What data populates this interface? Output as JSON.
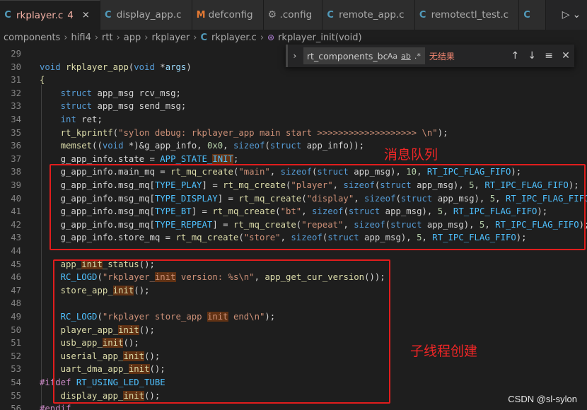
{
  "tabs": [
    {
      "icon": "C",
      "label": "rkplayer.c",
      "badge": "4",
      "close": "×",
      "active": true
    },
    {
      "icon": "C",
      "label": "display_app.c"
    },
    {
      "icon": "M",
      "label": "defconfig"
    },
    {
      "icon": "⚙",
      "label": ".config"
    },
    {
      "icon": "C",
      "label": "remote_app.c"
    },
    {
      "icon": "C",
      "label": "remotectl_test.c"
    },
    {
      "icon": "C",
      "label": ""
    }
  ],
  "tab_actions": {
    "run": "▷",
    "dropdown": "⌄"
  },
  "breadcrumb": {
    "items": [
      "components",
      "hifi4",
      "rtt",
      "app",
      "rkplayer"
    ],
    "file_icon": "C",
    "file": "rkplayer.c",
    "function_icon": "⊛",
    "function": "rkplayer_init(void)"
  },
  "find_widget": {
    "query": "rt_components_bc",
    "opt_case": "Aa",
    "opt_word": "ab",
    "opt_regex": ".*",
    "result": "无结果",
    "toggle": "›",
    "prev": "↑",
    "next": "↓",
    "selection": "≡",
    "close": "✕"
  },
  "annotations": {
    "queue_note": "消息队列",
    "thread_note": "子线程创建"
  },
  "watermark": "CSDN @sl-sylon",
  "code": [
    {
      "n": "29",
      "t": [
        [
          "",
          ""
        ]
      ]
    },
    {
      "n": "30",
      "t": [
        [
          "kw",
          "void"
        ],
        [
          "",
          " "
        ],
        [
          "fn",
          "rkplayer_app"
        ],
        [
          "",
          "("
        ],
        [
          "kw",
          "void"
        ],
        [
          "",
          " *"
        ],
        [
          "var",
          "args"
        ],
        [
          "",
          ")"
        ]
      ]
    },
    {
      "n": "31",
      "t": [
        [
          "fn",
          "{"
        ]
      ]
    },
    {
      "n": "32",
      "t": [
        [
          "",
          "    "
        ],
        [
          "kw",
          "struct"
        ],
        [
          "",
          " app_msg rcv_msg;"
        ]
      ]
    },
    {
      "n": "33",
      "t": [
        [
          "",
          "    "
        ],
        [
          "kw",
          "struct"
        ],
        [
          "",
          " app_msg send_msg;"
        ]
      ]
    },
    {
      "n": "34",
      "t": [
        [
          "",
          "    "
        ],
        [
          "kw",
          "int"
        ],
        [
          "",
          " ret;"
        ]
      ]
    },
    {
      "n": "35",
      "t": [
        [
          "",
          "    "
        ],
        [
          "fn",
          "rt_kprintf"
        ],
        [
          "",
          "("
        ],
        [
          "str",
          "\"sylon debug: rkplayer_app main start >>>>>>>>>>>>>>>>>>> \\n\""
        ],
        [
          "",
          ");"
        ]
      ]
    },
    {
      "n": "36",
      "t": [
        [
          "",
          "    "
        ],
        [
          "fn",
          "memset"
        ],
        [
          "",
          "(("
        ],
        [
          "kw",
          "void"
        ],
        [
          "",
          " *)&g_app_info, "
        ],
        [
          "num",
          "0x0"
        ],
        [
          "",
          ", "
        ],
        [
          "kw",
          "sizeof"
        ],
        [
          "",
          "("
        ],
        [
          "kw",
          "struct"
        ],
        [
          "",
          " app_info));"
        ]
      ]
    },
    {
      "n": "37",
      "t": [
        [
          "",
          "    g_app_info.state = "
        ],
        [
          "mac",
          "APP_STATE_"
        ],
        [
          "mac hl",
          "INIT"
        ],
        [
          "",
          ";"
        ]
      ]
    },
    {
      "n": "38",
      "t": [
        [
          "",
          "    g_app_info.main_mq = "
        ],
        [
          "fn",
          "rt_mq_create"
        ],
        [
          "",
          "("
        ],
        [
          "str",
          "\"main\""
        ],
        [
          "",
          ", "
        ],
        [
          "kw",
          "sizeof"
        ],
        [
          "",
          "("
        ],
        [
          "kw",
          "struct"
        ],
        [
          "",
          " app_msg), "
        ],
        [
          "num",
          "10"
        ],
        [
          "",
          ", "
        ],
        [
          "mac",
          "RT_IPC_FLAG_FIFO"
        ],
        [
          "",
          ");"
        ]
      ]
    },
    {
      "n": "39",
      "t": [
        [
          "",
          "    g_app_info.msg_mq["
        ],
        [
          "mac",
          "TYPE_PLAY"
        ],
        [
          "",
          "] = "
        ],
        [
          "fn",
          "rt_mq_create"
        ],
        [
          "",
          "("
        ],
        [
          "str",
          "\"player\""
        ],
        [
          "",
          ", "
        ],
        [
          "kw",
          "sizeof"
        ],
        [
          "",
          "("
        ],
        [
          "kw",
          "struct"
        ],
        [
          "",
          " app_msg), "
        ],
        [
          "num",
          "5"
        ],
        [
          "",
          ", "
        ],
        [
          "mac",
          "RT_IPC_FLAG_FIFO"
        ],
        [
          "",
          ");"
        ]
      ]
    },
    {
      "n": "40",
      "t": [
        [
          "",
          "    g_app_info.msg_mq["
        ],
        [
          "mac",
          "TYPE_DISPLAY"
        ],
        [
          "",
          "] = "
        ],
        [
          "fn",
          "rt_mq_create"
        ],
        [
          "",
          "("
        ],
        [
          "str",
          "\"display\""
        ],
        [
          "",
          ", "
        ],
        [
          "kw",
          "sizeof"
        ],
        [
          "",
          "("
        ],
        [
          "kw",
          "struct"
        ],
        [
          "",
          " app_msg), "
        ],
        [
          "num",
          "5"
        ],
        [
          "",
          ", "
        ],
        [
          "mac",
          "RT_IPC_FLAG_FIFO"
        ],
        [
          "",
          ");"
        ]
      ]
    },
    {
      "n": "41",
      "t": [
        [
          "",
          "    g_app_info.msg_mq["
        ],
        [
          "mac",
          "TYPE_BT"
        ],
        [
          "",
          "] = "
        ],
        [
          "fn",
          "rt_mq_create"
        ],
        [
          "",
          "("
        ],
        [
          "str",
          "\"bt\""
        ],
        [
          "",
          ", "
        ],
        [
          "kw",
          "sizeof"
        ],
        [
          "",
          "("
        ],
        [
          "kw",
          "struct"
        ],
        [
          "",
          " app_msg), "
        ],
        [
          "num",
          "5"
        ],
        [
          "",
          ", "
        ],
        [
          "mac",
          "RT_IPC_FLAG_FIFO"
        ],
        [
          "",
          ");"
        ]
      ]
    },
    {
      "n": "42",
      "t": [
        [
          "",
          "    g_app_info.msg_mq["
        ],
        [
          "mac",
          "TYPE_REPEAT"
        ],
        [
          "",
          "] = "
        ],
        [
          "fn",
          "rt_mq_create"
        ],
        [
          "",
          "("
        ],
        [
          "str",
          "\"repeat\""
        ],
        [
          "",
          ", "
        ],
        [
          "kw",
          "sizeof"
        ],
        [
          "",
          "("
        ],
        [
          "kw",
          "struct"
        ],
        [
          "",
          " app_msg), "
        ],
        [
          "num",
          "5"
        ],
        [
          "",
          ", "
        ],
        [
          "mac",
          "RT_IPC_FLAG_FIFO"
        ],
        [
          "",
          ");"
        ]
      ]
    },
    {
      "n": "43",
      "t": [
        [
          "",
          "    g_app_info.store_mq = "
        ],
        [
          "fn",
          "rt_mq_create"
        ],
        [
          "",
          "("
        ],
        [
          "str",
          "\"store\""
        ],
        [
          "",
          ", "
        ],
        [
          "kw",
          "sizeof"
        ],
        [
          "",
          "("
        ],
        [
          "kw",
          "struct"
        ],
        [
          "",
          " app_msg), "
        ],
        [
          "num",
          "5"
        ],
        [
          "",
          ", "
        ],
        [
          "mac",
          "RT_IPC_FLAG_FIFO"
        ],
        [
          "",
          ");"
        ]
      ]
    },
    {
      "n": "44",
      "t": [
        [
          "",
          ""
        ]
      ]
    },
    {
      "n": "45",
      "t": [
        [
          "",
          "    "
        ],
        [
          "fn",
          "app_"
        ],
        [
          "fn hl",
          "init"
        ],
        [
          "fn",
          "_status"
        ],
        [
          "",
          "();"
        ]
      ]
    },
    {
      "n": "46",
      "t": [
        [
          "",
          "    "
        ],
        [
          "mac",
          "RC_LOGD"
        ],
        [
          "",
          "("
        ],
        [
          "str",
          "\"rkplayer_"
        ],
        [
          "str hl",
          "init"
        ],
        [
          "str",
          " version: %s\\n\""
        ],
        [
          "",
          ", "
        ],
        [
          "fn",
          "app_get_cur_version"
        ],
        [
          "",
          "());"
        ]
      ]
    },
    {
      "n": "47",
      "t": [
        [
          "",
          "    "
        ],
        [
          "fn",
          "store_app_"
        ],
        [
          "fn hl",
          "init"
        ],
        [
          "",
          "();"
        ]
      ]
    },
    {
      "n": "48",
      "t": [
        [
          "",
          ""
        ]
      ]
    },
    {
      "n": "49",
      "t": [
        [
          "",
          "    "
        ],
        [
          "mac",
          "RC_LOGD"
        ],
        [
          "",
          "("
        ],
        [
          "str",
          "\"rkplayer store_app "
        ],
        [
          "str hl",
          "init"
        ],
        [
          "str",
          " end\\n\""
        ],
        [
          "",
          ");"
        ]
      ]
    },
    {
      "n": "50",
      "t": [
        [
          "",
          "    "
        ],
        [
          "fn",
          "player_app_"
        ],
        [
          "fn hl",
          "init"
        ],
        [
          "",
          "();"
        ]
      ]
    },
    {
      "n": "51",
      "t": [
        [
          "",
          "    "
        ],
        [
          "fn",
          "usb_app_"
        ],
        [
          "fn hl",
          "init"
        ],
        [
          "",
          "();"
        ]
      ]
    },
    {
      "n": "52",
      "t": [
        [
          "",
          "    "
        ],
        [
          "fn",
          "userial_app_"
        ],
        [
          "fn hl",
          "init"
        ],
        [
          "",
          "();"
        ]
      ]
    },
    {
      "n": "53",
      "t": [
        [
          "",
          "    "
        ],
        [
          "fn",
          "uart_dma_app_"
        ],
        [
          "fn hl",
          "init"
        ],
        [
          "",
          "();"
        ]
      ]
    },
    {
      "n": "54",
      "t": [
        [
          "pp",
          "#if"
        ],
        [
          "pp",
          "def"
        ],
        [
          "",
          " "
        ],
        [
          "mac",
          "RT_USING_LED_TUBE"
        ]
      ]
    },
    {
      "n": "55",
      "t": [
        [
          "",
          "    "
        ],
        [
          "fn",
          "display_app_"
        ],
        [
          "fn hl",
          "init"
        ],
        [
          "",
          "();"
        ]
      ]
    },
    {
      "n": "56",
      "t": [
        [
          "pp",
          "#endif"
        ]
      ]
    }
  ]
}
